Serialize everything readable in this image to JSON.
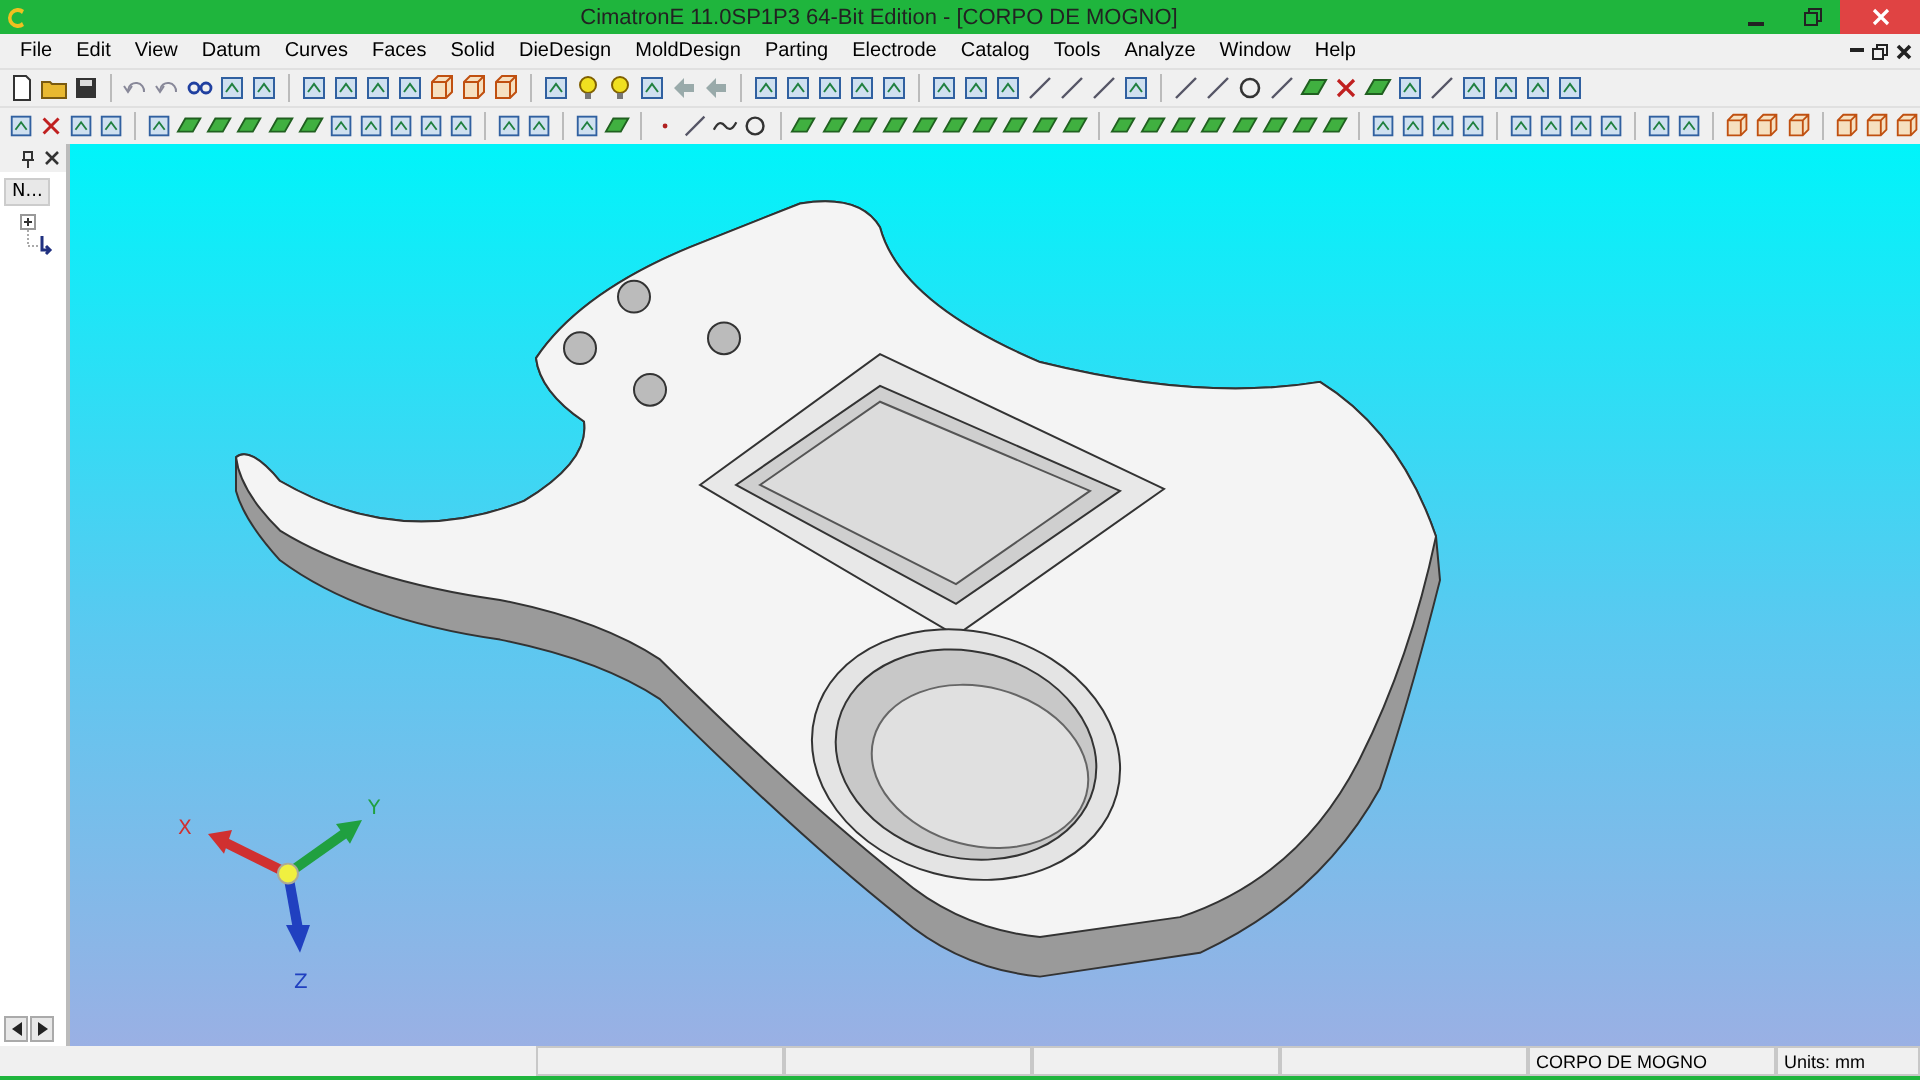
{
  "window": {
    "title": "CimatronE 11.0SP1P3 64-Bit Edition - [CORPO DE MOGNO]"
  },
  "menu": [
    "File",
    "Edit",
    "View",
    "Datum",
    "Curves",
    "Faces",
    "Solid",
    "DieDesign",
    "MoldDesign",
    "Parting",
    "Electrode",
    "Catalog",
    "Tools",
    "Analyze",
    "Window",
    "Help"
  ],
  "side_panel": {
    "tab": "N..."
  },
  "axes": [
    {
      "label": "X",
      "color": "#d03030"
    },
    {
      "label": "Y",
      "color": "#20a040"
    },
    {
      "label": "Z",
      "color": "#2040c0"
    }
  ],
  "status_bar": {
    "fields": [
      "CORPO DE MOGNO",
      "Units: mm"
    ]
  }
}
